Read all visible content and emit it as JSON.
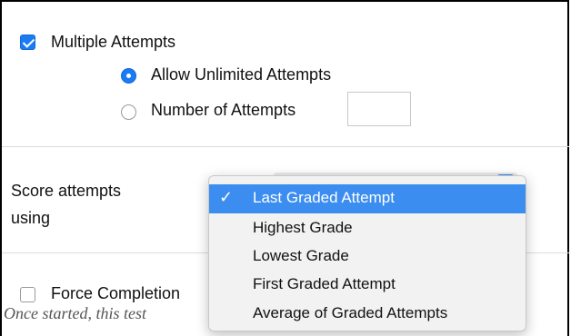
{
  "multiple_attempts": {
    "label": "Multiple Attempts",
    "checked": true
  },
  "attempt_options": [
    {
      "label": "Allow Unlimited Attempts",
      "selected": true
    },
    {
      "label": "Number of Attempts",
      "selected": false
    }
  ],
  "number_of_attempts_value": "",
  "score_attempts": {
    "label_line1": "Score attempts",
    "label_line2": "using",
    "selected": "Last Graded Attempt",
    "options": [
      "Last Graded Attempt",
      "Highest Grade",
      "Lowest Grade",
      "First Graded Attempt",
      "Average of Graded Attempts"
    ]
  },
  "force_completion": {
    "label": "Force Completion",
    "checked": false
  },
  "description": "Once started, this test",
  "colors": {
    "accent": "#1a7cf5",
    "highlight": "#3b8ef0"
  },
  "icons": {
    "check": "check-icon"
  }
}
